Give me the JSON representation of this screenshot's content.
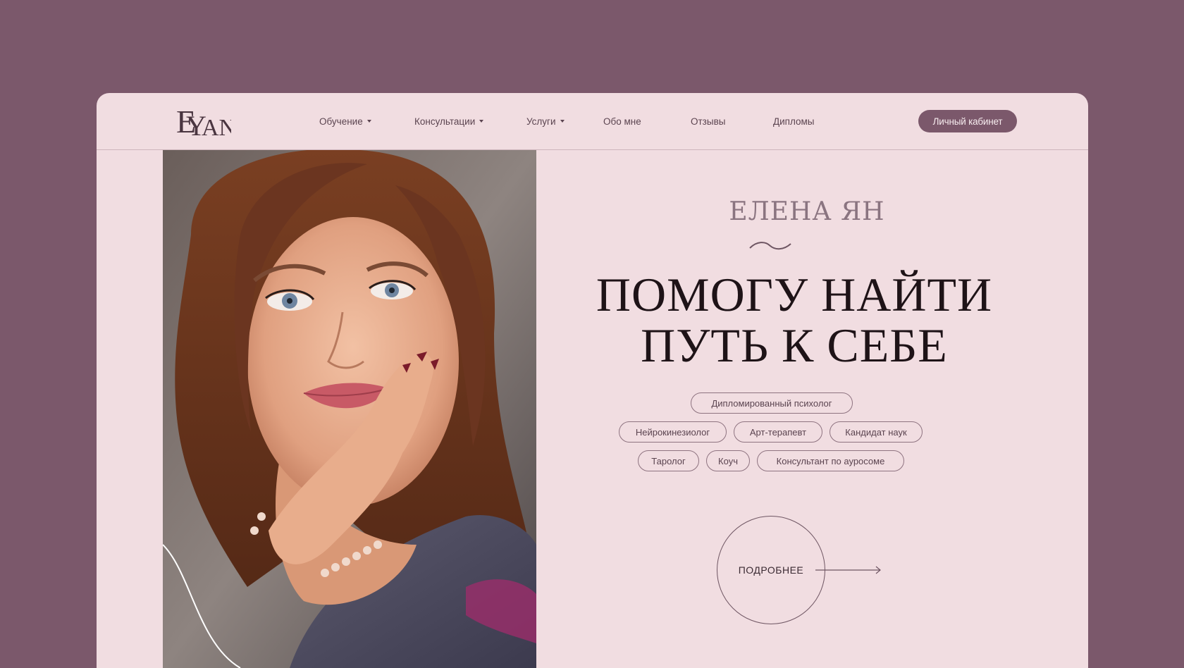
{
  "logo": {
    "icon": "ey-monogram-logo",
    "text": "EYAN"
  },
  "nav": {
    "items": [
      {
        "label": "Обучение",
        "dropdown": true
      },
      {
        "label": "Консультации",
        "dropdown": true
      },
      {
        "label": "Услуги",
        "dropdown": true
      },
      {
        "label": "Обо мне",
        "dropdown": false
      },
      {
        "label": "Отзывы",
        "dropdown": false
      },
      {
        "label": "Дипломы",
        "dropdown": false
      }
    ],
    "cabinet_label": "Личный кабинет"
  },
  "hero": {
    "name": "ЕЛЕНА ЯН",
    "headline_line1": "ПОМОГУ НАЙТИ",
    "headline_line2": "ПУТЬ К СЕБЕ",
    "tags_row1": [
      "Дипломированный психолог"
    ],
    "tags_row2": [
      "Нейрокинезиолог",
      "Арт-терапевт",
      "Кандидат наук"
    ],
    "tags_row3": [
      "Таролог",
      "Коуч",
      "Консультант по ауросоме"
    ],
    "more_label": "ПОДРОБНЕЕ",
    "photo": "portrait-photo"
  },
  "colors": {
    "background": "#7b586b",
    "card": "#f1dde1",
    "accent": "#7b586b",
    "text_dark": "#1e1317"
  }
}
